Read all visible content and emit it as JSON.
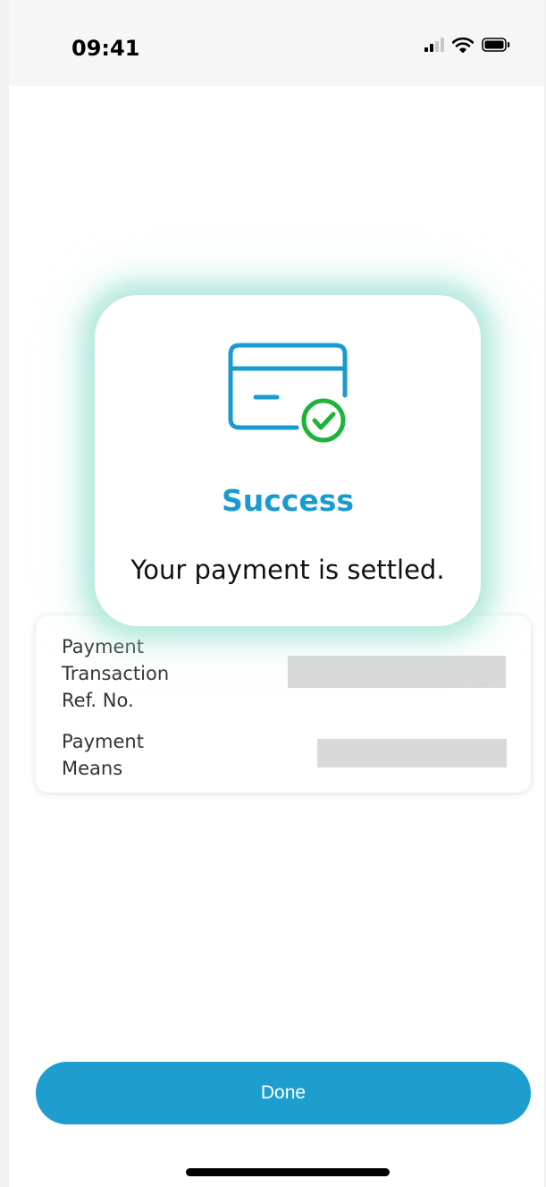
{
  "status_bar": {
    "time": "09:41",
    "icons": [
      "cellular-signal-icon",
      "wifi-icon",
      "battery-icon"
    ]
  },
  "modal": {
    "icon": "credit-card-check-icon",
    "title": "Success",
    "message": "Your payment is settled."
  },
  "details": {
    "rows": [
      {
        "label": "Payment\nTransaction\nRef. No.",
        "value": ""
      },
      {
        "label": "Payment\nMeans",
        "value": ""
      }
    ]
  },
  "actions": {
    "done_label": "Done"
  },
  "colors": {
    "accent": "#1d9ece",
    "title": "#1a9bd0",
    "success": "#1fb33a",
    "glow": "#8cdccd",
    "redacted": "#d9d9d9"
  }
}
